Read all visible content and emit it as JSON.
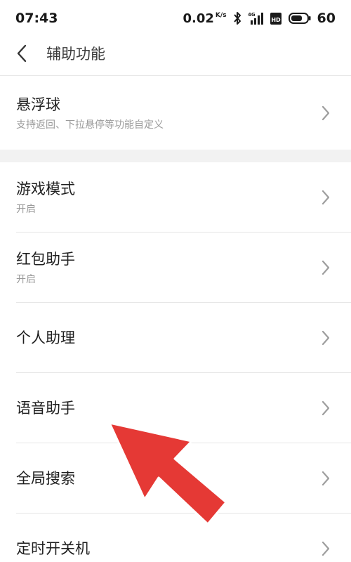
{
  "status_bar": {
    "time": "07:43",
    "net_speed": "0.02",
    "net_unit_top": "K/",
    "net_unit_bottom": "s",
    "signal_label": "4G",
    "hd_label": "HD",
    "battery": "60"
  },
  "nav": {
    "title": "辅助功能"
  },
  "rows": [
    {
      "title": "悬浮球",
      "subtitle": "支持返回、下拉悬停等功能自定义"
    },
    {
      "title": "游戏模式",
      "subtitle": "开启"
    },
    {
      "title": "红包助手",
      "subtitle": "开启"
    },
    {
      "title": "个人助理"
    },
    {
      "title": "语音助手"
    },
    {
      "title": "全局搜索"
    },
    {
      "title": "定时开关机"
    }
  ],
  "colors": {
    "arrow": "#e53935",
    "arrow_outline": "#ffffff",
    "chevron": "#9e9e9e",
    "section_gap": "#f2f2f2"
  },
  "icons": {
    "back": "chevron-left-icon",
    "row_arrow": "chevron-right-icon",
    "bluetooth": "bluetooth-icon",
    "signal": "signal-icon",
    "hd": "hd-icon",
    "battery": "battery-icon"
  }
}
